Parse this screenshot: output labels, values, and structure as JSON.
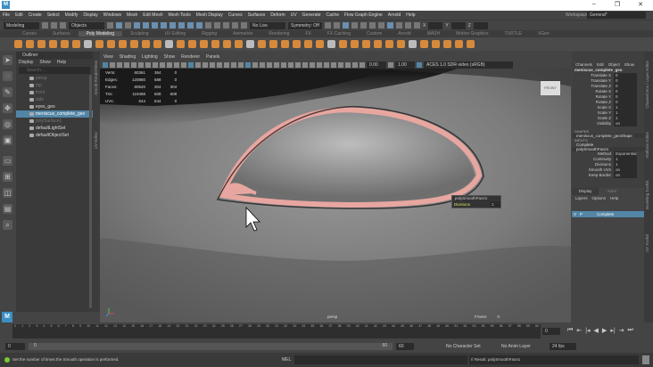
{
  "title_bar": {
    "app_icon": "M",
    "minimize": "–",
    "maximize": "❐",
    "close": "✕"
  },
  "menu": [
    "File",
    "Edit",
    "Create",
    "Select",
    "Modify",
    "Display",
    "Windows",
    "Mesh",
    "Edit Mesh",
    "Mesh Tools",
    "Mesh Display",
    "Curves",
    "Surfaces",
    "Deform",
    "UV",
    "Generate",
    "Cache",
    "Flow Graph Engine",
    "Arnold",
    "Help"
  ],
  "status_line": {
    "mode": "Modeling",
    "selection": "Objects",
    "live_surface": "No Live Surface",
    "symmetry": "Symmetry: Off",
    "x": "X",
    "y": "Y",
    "z": "Z",
    "workspace_label": "Workspace :",
    "workspace": "General*"
  },
  "shelf_tabs": [
    "Curves",
    "Surfaces",
    "Poly Modeling",
    "Sculpting",
    "UV Editing",
    "Rigging",
    "Animation",
    "Rendering",
    "FX",
    "FX Caching",
    "Custom",
    "Arnold",
    "MASH",
    "Motion Graphics",
    "TURTLE",
    "XGen"
  ],
  "shelf_active": "Poly Modeling",
  "outliner": {
    "title": "Outliner",
    "menu": [
      "Display",
      "Show",
      "Help"
    ],
    "search_placeholder": "Search...",
    "items": [
      {
        "label": "persp",
        "state": "dim"
      },
      {
        "label": "top",
        "state": "dim"
      },
      {
        "label": "front",
        "state": "dim"
      },
      {
        "label": "side",
        "state": "dim"
      },
      {
        "label": "eyes_geo",
        "state": ""
      },
      {
        "label": "meniscus_complete_geo",
        "state": "sel"
      },
      {
        "label": "polySurface1",
        "state": "dim"
      },
      {
        "label": "defaultLightSet",
        "state": ""
      },
      {
        "label": "defaultObjectSet",
        "state": ""
      }
    ]
  },
  "side_tabs": [
    "Arnold RenderView",
    "UV Editor"
  ],
  "viewport": {
    "menu": [
      "View",
      "Shading",
      "Lighting",
      "Show",
      "Renderer",
      "Panels"
    ],
    "exposure": "0.00",
    "gamma": "1.00",
    "color_space": "ACES 1.0 SDR-video (sRGB)",
    "hud": [
      [
        "Verts:",
        "60361",
        "364",
        "0"
      ],
      [
        "Edges:",
        "120880",
        "688",
        "0"
      ],
      [
        "Faces:",
        "60520",
        "304",
        "304"
      ],
      [
        "Tris:",
        "119488",
        "608",
        "608"
      ],
      [
        "UVs:",
        "644",
        "644",
        "0"
      ]
    ],
    "view_cube": "FRONT",
    "panel_name": "persp",
    "frame_label": "Frame:",
    "frame_value": "0",
    "smooth_popup": {
      "title": "polySmoothFace1",
      "attr": "Divisions",
      "value": "1"
    }
  },
  "channel_box": {
    "menu": [
      "Channels",
      "Edit",
      "Object",
      "Show"
    ],
    "object": "meniscus_complete_geo",
    "attrs": [
      [
        "Translate X",
        "0"
      ],
      [
        "Translate Y",
        "0"
      ],
      [
        "Translate Z",
        "0"
      ],
      [
        "Rotate X",
        "0"
      ],
      [
        "Rotate Y",
        "0"
      ],
      [
        "Rotate Z",
        "0"
      ],
      [
        "Scale X",
        "1"
      ],
      [
        "Scale Y",
        "1"
      ],
      [
        "Scale Z",
        "1"
      ],
      [
        "Visibility",
        "on"
      ]
    ],
    "shapes_label": "SHAPES",
    "shape": "meniscus_complete_geoShape",
    "inputs_label": "INPUTS",
    "input1": "Complete",
    "input2": "polySmoothFace1",
    "smooth_attrs": [
      [
        "Method",
        "Exponential"
      ],
      [
        "Continuity",
        "1"
      ],
      [
        "Divisions",
        "1"
      ],
      [
        "Smooth UVs",
        "on"
      ],
      [
        "Keep Border",
        "on"
      ]
    ]
  },
  "layer_editor": {
    "tabs": [
      "Display",
      "Anim"
    ],
    "menu": [
      "Layers",
      "Options",
      "Help"
    ],
    "layer": {
      "v": "V",
      "p": "P",
      "name": "Complete"
    }
  },
  "right_tabs": [
    "Channel Box / Layer Editor",
    "Attribute Editor",
    "Modeling Toolkit",
    "UV Toolkit"
  ],
  "timeline": {
    "ticks": [
      "0",
      "1",
      "2",
      "3",
      "4",
      "5",
      "6",
      "7",
      "8",
      "9",
      "10",
      "11",
      "12",
      "13",
      "14",
      "15",
      "16",
      "17",
      "18",
      "19",
      "20",
      "21",
      "22",
      "23",
      "24",
      "25",
      "26",
      "27",
      "28",
      "29",
      "30",
      "31",
      "32",
      "33",
      "34",
      "35",
      "36",
      "37",
      "38",
      "39",
      "40",
      "41",
      "42",
      "43",
      "44",
      "45",
      "46",
      "47",
      "48",
      "49",
      "50",
      "51",
      "52",
      "53",
      "54",
      "55",
      "56",
      "57",
      "58",
      "59",
      "60"
    ],
    "current": "0"
  },
  "range": {
    "start": "0",
    "inner_start": "0",
    "inner_end": "60",
    "end": "60",
    "character_set": "No Character Set",
    "anim_layer": "No Anim Layer",
    "fps": "24 fps"
  },
  "command": {
    "help": "Set the number of times the Smooth operation is performed.",
    "lang": "MEL",
    "result": "// Result: polySmoothFace1"
  },
  "colors": {
    "accent": "#5285a6",
    "mesh": "#e8a6a0"
  }
}
